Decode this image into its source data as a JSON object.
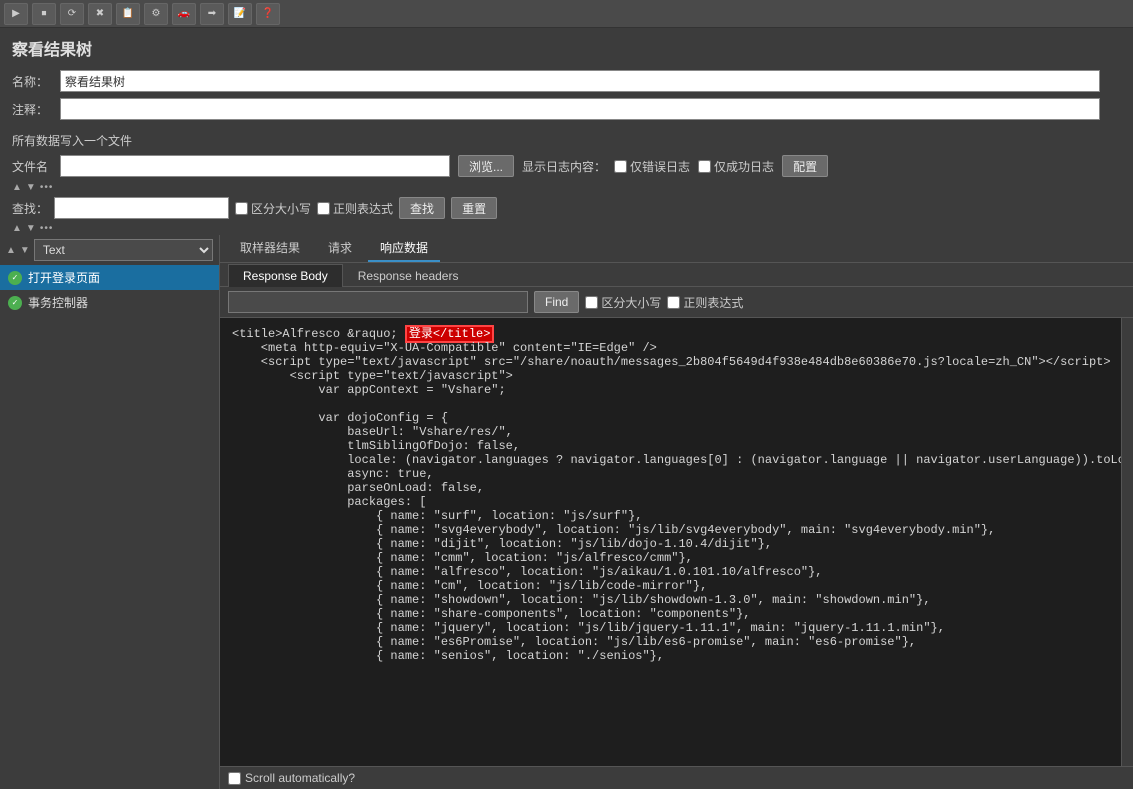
{
  "title": "察看结果树",
  "toolbar": {
    "buttons": [
      "▶",
      "⏹",
      "⟳",
      "✖",
      "📋",
      "🔧",
      "🚗",
      "➡",
      "📝",
      "❓"
    ]
  },
  "form": {
    "name_label": "名称：",
    "name_value": "察看结果树",
    "comment_label": "注释：",
    "comment_value": "",
    "file_section": "所有数据写入一个文件",
    "file_label": "文件名",
    "file_value": "",
    "browse_label": "浏览...",
    "log_content_label": "显示日志内容：",
    "error_log_label": "仅错误日志",
    "success_log_label": "仅成功日志",
    "config_label": "配置"
  },
  "search": {
    "label": "查找：",
    "placeholder": "",
    "case_sensitive": "区分大小写",
    "regex": "正则表达式",
    "find_btn": "查找",
    "reset_btn": "重置"
  },
  "sidebar": {
    "dropdown_value": "Text",
    "items": [
      {
        "label": "打开登录页面",
        "icon": "green-check"
      },
      {
        "label": "事务控制器",
        "icon": "green-check"
      }
    ]
  },
  "tabs": {
    "items": [
      "取样器结果",
      "请求",
      "响应数据"
    ],
    "active": "响应数据"
  },
  "sub_tabs": {
    "items": [
      "Response Body",
      "Response headers"
    ],
    "active": "Response Body"
  },
  "find_bar": {
    "input_placeholder": "",
    "find_btn": "Find",
    "case_sensitive": "区分大小写",
    "regex": "正则表达式"
  },
  "code_content": {
    "highlight_text": "登录</title>",
    "line1": "<title>Alfresco &raquo; ",
    "line2": "    <meta http-equiv=\"X-UA-Compatible\" content=\"IE=Edge\" />",
    "line3": "    <script type=\"text/javascript\" src=\"/share/noauth/messages_2b804f5649d4f938e484db8e60386e70.js?locale=zh_CN\"><\\/script>",
    "line4": "        <script type=\"text/javascript\">",
    "line5": "            var appContext = \"Vshare\";",
    "line6": "",
    "line7": "            var dojoConfig = {",
    "line8": "                baseUrl: \"Vshare/res/\",",
    "line9": "                tlmSiblingOfDojo: false,",
    "line10": "                locale: (navigator.languages ? navigator.languages[0] : (navigator.language || navigator.userLanguage)).toLowerCase(),",
    "line11": "                async: true,",
    "line12": "                parseOnLoad: false,",
    "line13": "                packages: [",
    "line14": "                    { name: \"surf\", location: \"js/surf\"},",
    "line15": "                    { name: \"svg4everybody\", location: \"js/lib/svg4everybody\", main: \"svg4everybody.min\"},",
    "line16": "                    { name: \"dijit\", location: \"js/lib/dojo-1.10.4/dijit\"},",
    "line17": "                    { name: \"cmm\", location: \"js/alfresco/cmm\"},",
    "line18": "                    { name: \"alfresco\", location: \"js/aikau/1.0.101.10/alfresco\"},",
    "line19": "                    { name: \"cm\", location: \"js/lib/code-mirror\"},",
    "line20": "                    { name: \"showdown\", location: \"js/lib/showdown-1.3.0\", main: \"showdown.min\"},",
    "line21": "                    { name: \"share-components\", location: \"components\"},",
    "line22": "                    { name: \"jquery\", location: \"js/lib/jquery-1.11.1\", main: \"jquery-1.11.1.min\"},",
    "line23": "                    { name: \"es6Promise\", location: \"js/lib/es6-promise\", main: \"es6-promise\"},",
    "line24": "                    { name: \"senios\", location: \"./senios\"},"
  },
  "bottom": {
    "scroll_auto_label": "Scroll automatically?"
  }
}
